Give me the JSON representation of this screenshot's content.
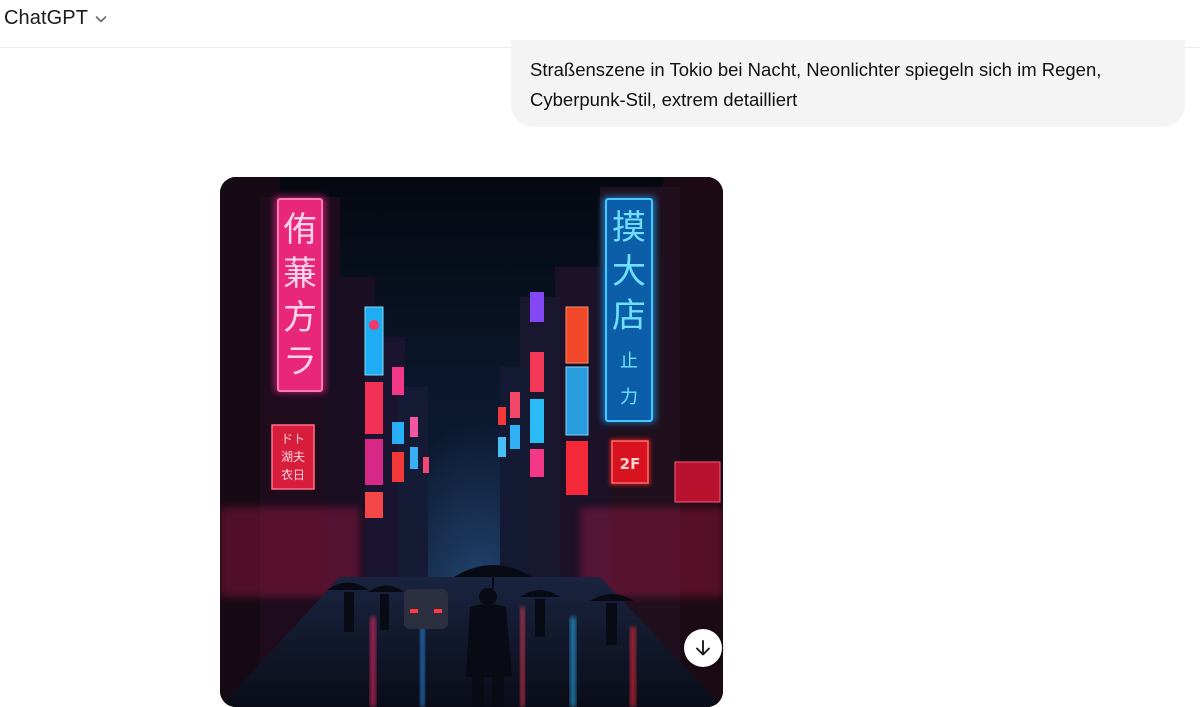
{
  "header": {
    "model_name": "ChatGPT",
    "model_switch_icon": "chevron-down-icon"
  },
  "conversation": {
    "user_message": "Straßenszene in Tokio bei Nacht, Neonlichter spiegeln sich im Regen, Cyberpunk-Stil, extrem detailliert",
    "generated_image": {
      "sign_left": [
        "侑",
        "蒹",
        "方",
        "ラ"
      ],
      "sign_right": [
        "摸",
        "大",
        "店"
      ],
      "sign_right_small": [
        "止",
        "力"
      ],
      "sign_2f": "2F",
      "sign_small_left": [
        "ドト",
        "湖夫",
        "衣日"
      ]
    },
    "download_icon": "arrow-down-icon"
  }
}
